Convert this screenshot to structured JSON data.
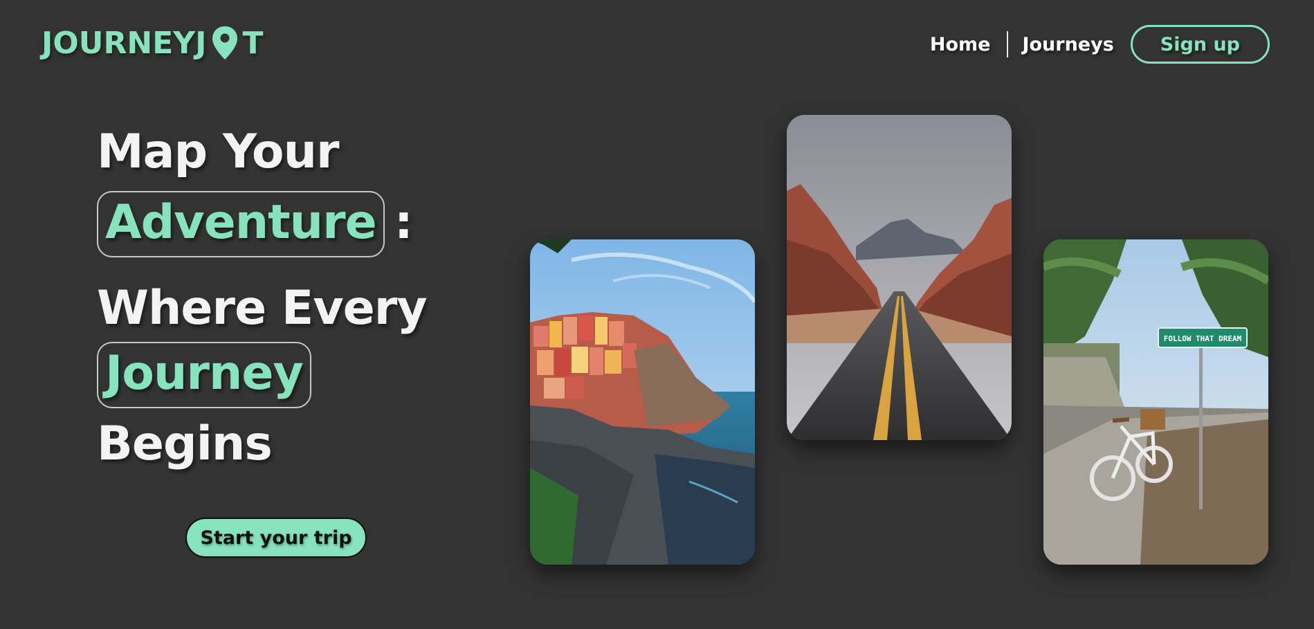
{
  "brand": {
    "name_start": "JOURNEYJ",
    "logo_icon": "map-pin-icon",
    "name_end": "T",
    "accent_color": "#86e3bd"
  },
  "nav": {
    "home": "Home",
    "journeys": "Journeys",
    "signup": "Sign up"
  },
  "hero": {
    "line1": "Map Your",
    "highlight1": "Adventure",
    "colon": ":",
    "line3": "Where Every",
    "highlight2": "Journey",
    "line5": "Begins",
    "cta": "Start your trip"
  },
  "gallery": [
    {
      "name": "cliffside-village-photo"
    },
    {
      "name": "desert-road-photo"
    },
    {
      "name": "bicycle-street-sign-photo",
      "sign_text": "FOLLOW THAT DREAM"
    }
  ]
}
